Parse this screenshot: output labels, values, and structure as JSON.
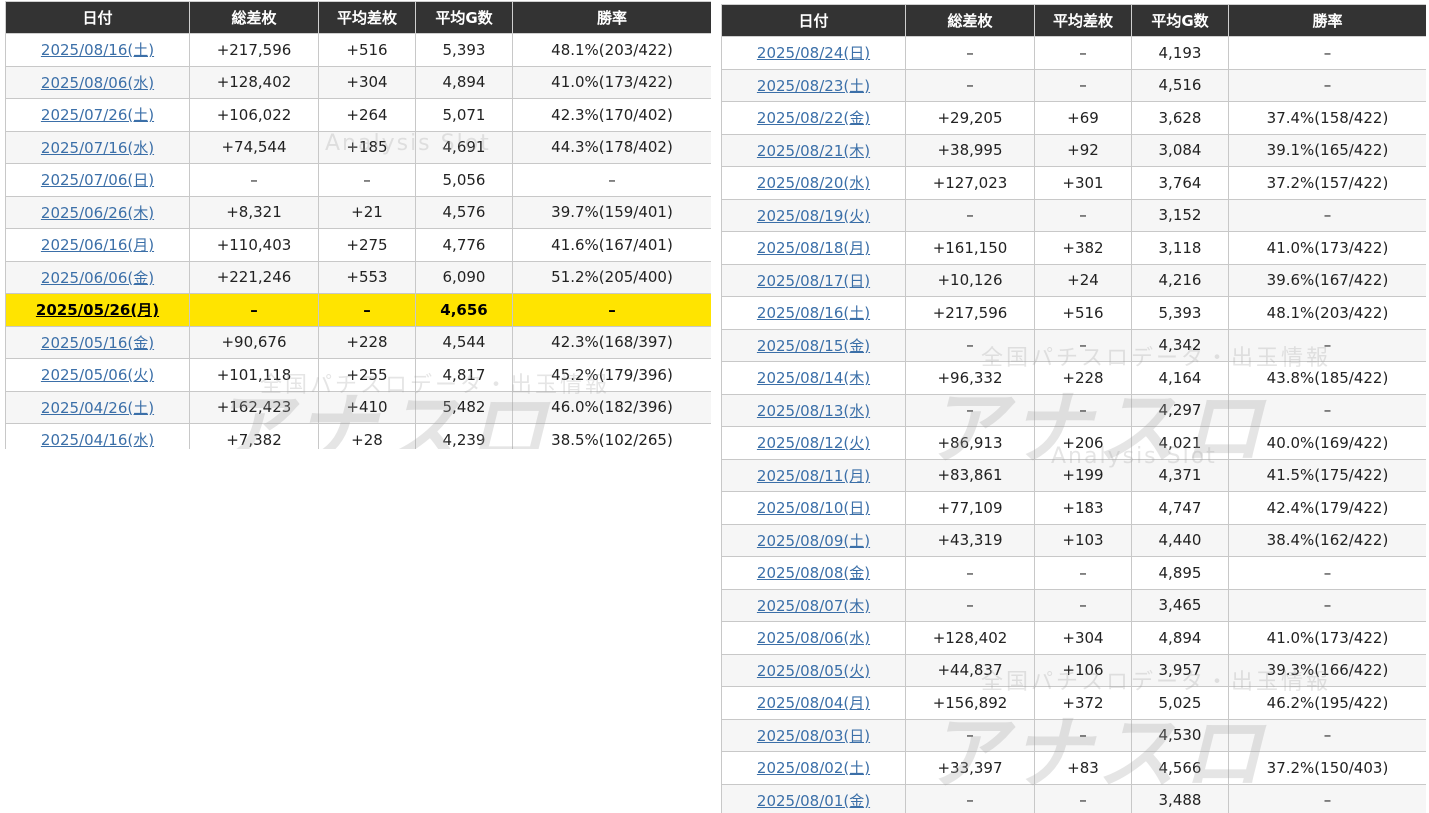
{
  "headers": [
    "日付",
    "総差枚",
    "平均差枚",
    "平均G数",
    "勝率"
  ],
  "watermark": {
    "top_text": "全国パチスロデータ・出玉情報",
    "logo_text": "アナスロ",
    "sub_text": "Analysis Slot"
  },
  "left_table": {
    "rows": [
      {
        "date": "2025/08/16(土)",
        "total": "+217,596",
        "avg": "+516",
        "games": "5,393",
        "win": "48.1%(203/422)"
      },
      {
        "date": "2025/08/06(水)",
        "total": "+128,402",
        "avg": "+304",
        "games": "4,894",
        "win": "41.0%(173/422)"
      },
      {
        "date": "2025/07/26(土)",
        "total": "+106,022",
        "avg": "+264",
        "games": "5,071",
        "win": "42.3%(170/402)"
      },
      {
        "date": "2025/07/16(水)",
        "total": "+74,544",
        "avg": "+185",
        "games": "4,691",
        "win": "44.3%(178/402)"
      },
      {
        "date": "2025/07/06(日)",
        "total": "–",
        "avg": "–",
        "games": "5,056",
        "win": "–"
      },
      {
        "date": "2025/06/26(木)",
        "total": "+8,321",
        "avg": "+21",
        "games": "4,576",
        "win": "39.7%(159/401)"
      },
      {
        "date": "2025/06/16(月)",
        "total": "+110,403",
        "avg": "+275",
        "games": "4,776",
        "win": "41.6%(167/401)"
      },
      {
        "date": "2025/06/06(金)",
        "total": "+221,246",
        "avg": "+553",
        "games": "6,090",
        "win": "51.2%(205/400)"
      },
      {
        "date": "2025/05/26(月)",
        "total": "–",
        "avg": "–",
        "games": "4,656",
        "win": "–",
        "highlight": true
      },
      {
        "date": "2025/05/16(金)",
        "total": "+90,676",
        "avg": "+228",
        "games": "4,544",
        "win": "42.3%(168/397)"
      },
      {
        "date": "2025/05/06(火)",
        "total": "+101,118",
        "avg": "+255",
        "games": "4,817",
        "win": "45.2%(179/396)"
      },
      {
        "date": "2025/04/26(土)",
        "total": "+162,423",
        "avg": "+410",
        "games": "5,482",
        "win": "46.0%(182/396)"
      },
      {
        "date": "2025/04/16(水)",
        "total": "+7,382",
        "avg": "+28",
        "games": "4,239",
        "win": "38.5%(102/265)"
      }
    ]
  },
  "right_table": {
    "rows": [
      {
        "date": "2025/08/24(日)",
        "total": "–",
        "avg": "–",
        "games": "4,193",
        "win": "–"
      },
      {
        "date": "2025/08/23(土)",
        "total": "–",
        "avg": "–",
        "games": "4,516",
        "win": "–"
      },
      {
        "date": "2025/08/22(金)",
        "total": "+29,205",
        "avg": "+69",
        "games": "3,628",
        "win": "37.4%(158/422)"
      },
      {
        "date": "2025/08/21(木)",
        "total": "+38,995",
        "avg": "+92",
        "games": "3,084",
        "win": "39.1%(165/422)"
      },
      {
        "date": "2025/08/20(水)",
        "total": "+127,023",
        "avg": "+301",
        "games": "3,764",
        "win": "37.2%(157/422)"
      },
      {
        "date": "2025/08/19(火)",
        "total": "–",
        "avg": "–",
        "games": "3,152",
        "win": "–"
      },
      {
        "date": "2025/08/18(月)",
        "total": "+161,150",
        "avg": "+382",
        "games": "3,118",
        "win": "41.0%(173/422)"
      },
      {
        "date": "2025/08/17(日)",
        "total": "+10,126",
        "avg": "+24",
        "games": "4,216",
        "win": "39.6%(167/422)"
      },
      {
        "date": "2025/08/16(土)",
        "total": "+217,596",
        "avg": "+516",
        "games": "5,393",
        "win": "48.1%(203/422)"
      },
      {
        "date": "2025/08/15(金)",
        "total": "–",
        "avg": "–",
        "games": "4,342",
        "win": "–"
      },
      {
        "date": "2025/08/14(木)",
        "total": "+96,332",
        "avg": "+228",
        "games": "4,164",
        "win": "43.8%(185/422)"
      },
      {
        "date": "2025/08/13(水)",
        "total": "–",
        "avg": "–",
        "games": "4,297",
        "win": "–"
      },
      {
        "date": "2025/08/12(火)",
        "total": "+86,913",
        "avg": "+206",
        "games": "4,021",
        "win": "40.0%(169/422)"
      },
      {
        "date": "2025/08/11(月)",
        "total": "+83,861",
        "avg": "+199",
        "games": "4,371",
        "win": "41.5%(175/422)"
      },
      {
        "date": "2025/08/10(日)",
        "total": "+77,109",
        "avg": "+183",
        "games": "4,747",
        "win": "42.4%(179/422)"
      },
      {
        "date": "2025/08/09(土)",
        "total": "+43,319",
        "avg": "+103",
        "games": "4,440",
        "win": "38.4%(162/422)"
      },
      {
        "date": "2025/08/08(金)",
        "total": "–",
        "avg": "–",
        "games": "4,895",
        "win": "–"
      },
      {
        "date": "2025/08/07(木)",
        "total": "–",
        "avg": "–",
        "games": "3,465",
        "win": "–"
      },
      {
        "date": "2025/08/06(水)",
        "total": "+128,402",
        "avg": "+304",
        "games": "4,894",
        "win": "41.0%(173/422)"
      },
      {
        "date": "2025/08/05(火)",
        "total": "+44,837",
        "avg": "+106",
        "games": "3,957",
        "win": "39.3%(166/422)"
      },
      {
        "date": "2025/08/04(月)",
        "total": "+156,892",
        "avg": "+372",
        "games": "5,025",
        "win": "46.2%(195/422)"
      },
      {
        "date": "2025/08/03(日)",
        "total": "–",
        "avg": "–",
        "games": "4,530",
        "win": "–"
      },
      {
        "date": "2025/08/02(土)",
        "total": "+33,397",
        "avg": "+83",
        "games": "4,566",
        "win": "37.2%(150/403)"
      },
      {
        "date": "2025/08/01(金)",
        "total": "–",
        "avg": "–",
        "games": "3,488",
        "win": "–"
      }
    ]
  }
}
